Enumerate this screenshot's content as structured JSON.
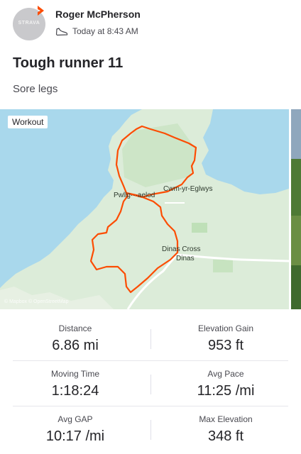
{
  "header": {
    "avatar_text": "STRAVA",
    "user_name": "Roger McPherson",
    "timestamp": "Today at 8:43 AM",
    "activity_icon": "shoe-icon",
    "badge_icon": "strava-chevron-icon",
    "badge_color": "#fc4c02"
  },
  "activity": {
    "title": "Tough runner 11",
    "description": "Sore legs"
  },
  "map": {
    "tag": "Workout",
    "places": {
      "pwllgwaelod": "Pwllg···aelod",
      "cwm_yr_eglwys": "Cwm-yr-Eglwys",
      "dinas_cross": "Dinas Cross",
      "dinas": "Dinas"
    },
    "attribution": "© Mapbox © OpenStreetMap",
    "route_color": "#fc4c02"
  },
  "stats": [
    {
      "label": "Distance",
      "value": "6.86 mi"
    },
    {
      "label": "Elevation Gain",
      "value": "953 ft"
    },
    {
      "label": "Moving Time",
      "value": "1:18:24"
    },
    {
      "label": "Avg Pace",
      "value": "11:25 /mi"
    },
    {
      "label": "Avg GAP",
      "value": "10:17 /mi"
    },
    {
      "label": "Max Elevation",
      "value": "348 ft"
    }
  ]
}
